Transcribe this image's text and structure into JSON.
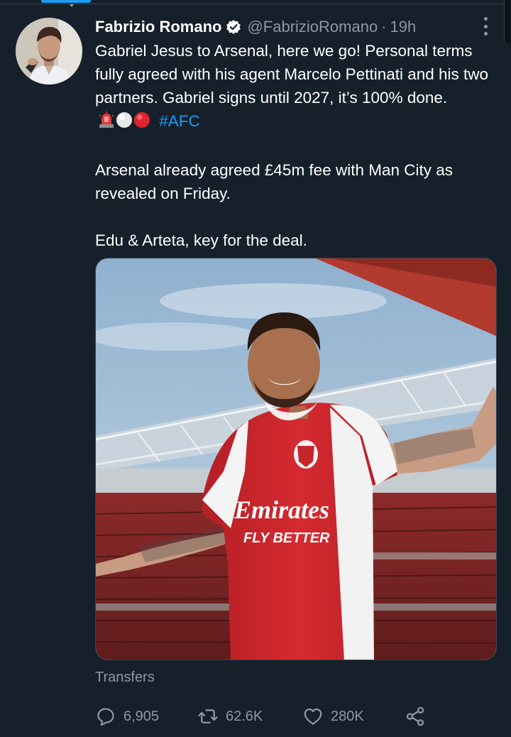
{
  "tweet": {
    "author": {
      "display_name": "Fabrizio Romano",
      "handle": "@FabrizioRomano",
      "verified": true
    },
    "separator": "·",
    "time": "19h",
    "text": {
      "para1": "Gabriel Jesus to Arsenal, here we go! Personal terms fully agreed with his agent Marcelo Pettinati and his two partners. Gabriel signs until 2027, it’s 100% done.",
      "hashtag": "#AFC",
      "para2": "Arsenal already agreed £45m fee with Man City as revealed on Friday.",
      "para3": "Edu & Arteta, key for the deal."
    },
    "emojis": [
      "siren-emoji",
      "white-circle-emoji",
      "red-circle-emoji"
    ],
    "media": {
      "shirt_sponsor_line1": "Emirates",
      "shirt_sponsor_line2": "FLY BETTER"
    },
    "topic": "Transfers",
    "actions": {
      "replies": "6,905",
      "retweets": "62.6K",
      "likes": "280K"
    }
  },
  "colors": {
    "background": "#15202b",
    "text": "#ffffff",
    "secondary_text": "#8b98a5",
    "accent": "#1d9bf0",
    "arsenal_red": "#d0272c"
  }
}
